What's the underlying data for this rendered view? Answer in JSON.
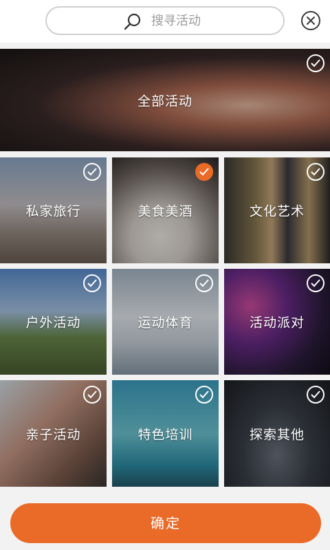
{
  "search": {
    "placeholder": "搜寻活动",
    "icon": "search-icon"
  },
  "close_icon": "close-circle-icon",
  "tiles": [
    {
      "label": "全部活动",
      "selected": false
    },
    {
      "label": "私家旅行",
      "selected": false
    },
    {
      "label": "美食美酒",
      "selected": true
    },
    {
      "label": "文化艺术",
      "selected": false
    },
    {
      "label": "户外活动",
      "selected": false
    },
    {
      "label": "运动体育",
      "selected": false
    },
    {
      "label": "活动派对",
      "selected": false
    },
    {
      "label": "亲子活动",
      "selected": false
    },
    {
      "label": "特色培训",
      "selected": false
    },
    {
      "label": "探索其他",
      "selected": false
    }
  ],
  "confirm_label": "确定",
  "colors": {
    "accent": "#ea6a27",
    "background": "#f2f2f2"
  }
}
